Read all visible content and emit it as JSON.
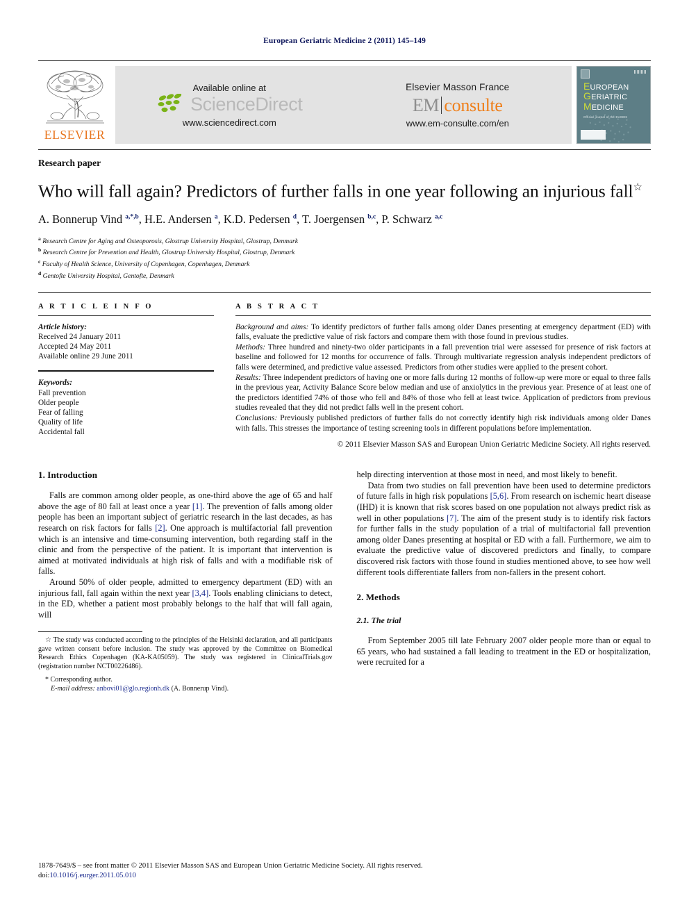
{
  "running_head": "European Geriatric Medicine 2 (2011) 145–149",
  "banner": {
    "elsevier_wordmark": "ELSEVIER",
    "available_online": "Available online at",
    "sciencedirect_word": "ScienceDirect",
    "sciencedirect_url": "www.sciencedirect.com",
    "masson_line": "Elsevier Masson France",
    "em_left": "EM",
    "em_right": "consulte",
    "emconsulte_url": "www.em-consulte.com/en",
    "cover": {
      "line1": "UROPEAN",
      "line2": "ERIATRIC",
      "line3": "EDICINE",
      "cap1": "E",
      "cap2": "G",
      "cap3": "M",
      "subtitle": "Official journal of the EUGMS",
      "bg_color": "#5d7e86",
      "accent_color": "#cddc39"
    }
  },
  "article": {
    "doctype": "Research paper",
    "title": "Who will fall again? Predictors of further falls in one year following an injurious fall",
    "title_footnote_mark": "☆",
    "authors_html": "A. Bonnerup Vind <sup>a,*,b</sup>, H.E. Andersen <sup>a</sup>, K.D. Pedersen <sup>d</sup>, T. Joergensen <sup>b,c</sup>, P. Schwarz <sup>a,c</sup>",
    "affiliations": [
      {
        "mark": "a",
        "text": "Research Centre for Aging and Osteoporosis, Glostrup University Hospital, Glostrup, Denmark"
      },
      {
        "mark": "b",
        "text": "Research Centre for Prevention and Health, Glostrup University Hospital, Glostrup, Denmark"
      },
      {
        "mark": "c",
        "text": "Faculty of Health Science, University of Copenhagen, Copenhagen, Denmark"
      },
      {
        "mark": "d",
        "text": "Gentofte University Hospital, Gentofte, Denmark"
      }
    ]
  },
  "article_info": {
    "heading": "A R T I C L E    I N F O",
    "history_label": "Article history:",
    "history": [
      "Received 24 January 2011",
      "Accepted 24 May 2011",
      "Available online 29 June 2011"
    ],
    "keywords_label": "Keywords:",
    "keywords": [
      "Fall prevention",
      "Older people",
      "Fear of falling",
      "Quality of life",
      "Accidental fall"
    ]
  },
  "abstract": {
    "heading": "A B S T R A C T",
    "sections": [
      {
        "label": "Background and aims:",
        "text": "To identify predictors of further falls among older Danes presenting at emergency department (ED) with falls, evaluate the predictive value of risk factors and compare them with those found in previous studies."
      },
      {
        "label": "Methods:",
        "text": "Three hundred and ninety-two older participants in a fall prevention trial were assessed for presence of risk factors at baseline and followed for 12 months for occurrence of falls. Through multivariate regression analysis independent predictors of falls were determined, and predictive value assessed. Predictors from other studies were applied to the present cohort."
      },
      {
        "label": "Results:",
        "text": "Three independent predictors of having one or more falls during 12 months of follow-up were more or equal to three falls in the previous year, Activity Balance Score below median and use of anxiolytics in the previous year. Presence of at least one of the predictors identified 74% of those who fell and 84% of those who fell at least twice. Application of predictors from previous studies revealed that they did not predict falls well in the present cohort."
      },
      {
        "label": "Conclusions:",
        "text": "Previously published predictors of further falls do not correctly identify high risk individuals among older Danes with falls. This stresses the importance of testing screening tools in different populations before implementation."
      }
    ],
    "copyright": "© 2011 Elsevier Masson SAS and European Union Geriatric Medicine Society. All rights reserved."
  },
  "body": {
    "left_column": {
      "section_heading": "1. Introduction",
      "paragraphs": [
        "Falls are common among older people, as one-third above the age of 65 and half above the age of 80 fall at least once a year [1]. The prevention of falls among older people has been an important subject of geriatric research in the last decades, as has research on risk factors for falls [2]. One approach is multifactorial fall prevention which is an intensive and time-consuming intervention, both regarding staff in the clinic and from the perspective of the patient. It is important that intervention is aimed at motivated individuals at high risk of falls and with a modifiable risk of falls.",
        "Around 50% of older people, admitted to emergency department (ED) with an injurious fall, fall again within the next year [3,4]. Tools enabling clinicians to detect, in the ED, whether a patient most probably belongs to the half that will fall again, will"
      ]
    },
    "right_column": {
      "paragraphs": [
        "help directing intervention at those most in need, and most likely to benefit.",
        "Data from two studies on fall prevention have been used to determine predictors of future falls in high risk populations [5,6]. From research on ischemic heart disease (IHD) it is known that risk scores based on one population not always predict risk as well in other populations [7]. The aim of the present study is to identify risk factors for further falls in the study population of a trial of multifactorial fall prevention among older Danes presenting at hospital or ED with a fall. Furthermore, we aim to evaluate the predictive value of discovered predictors and finally, to compare discovered risk factors with those found in studies mentioned above, to see how well different tools differentiate fallers from non-fallers in the present cohort."
      ],
      "section_heading": "2. Methods",
      "subsection_heading": "2.1. The trial",
      "subsection_paragraph": "From September 2005 till late February 2007 older people more than or equal to 65 years, who had sustained a fall leading to treatment in the ED or hospitalization, were recruited for a"
    }
  },
  "footnotes": {
    "star_mark": "☆",
    "star_text": "The study was conducted according to the principles of the Helsinki declaration, and all participants gave written consent before inclusion. The study was approved by the Committee on Biomedical Research Ethics Copenhagen (KA-KA05059). The study was registered in ClinicalTrials.gov (registration number NCT00226486).",
    "corresponding_mark": "*",
    "corresponding_text": "Corresponding author.",
    "email_label": "E-mail address:",
    "email": "anbovi01@glo.regionh.dk",
    "email_owner": "(A. Bonnerup Vind)."
  },
  "footer": {
    "issn_line": "1878-7649/$ – see front matter © 2011 Elsevier Masson SAS and European Union Geriatric Medicine Society. All rights reserved.",
    "doi_label": "doi:",
    "doi": "10.1016/j.eurger.2011.05.010"
  }
}
